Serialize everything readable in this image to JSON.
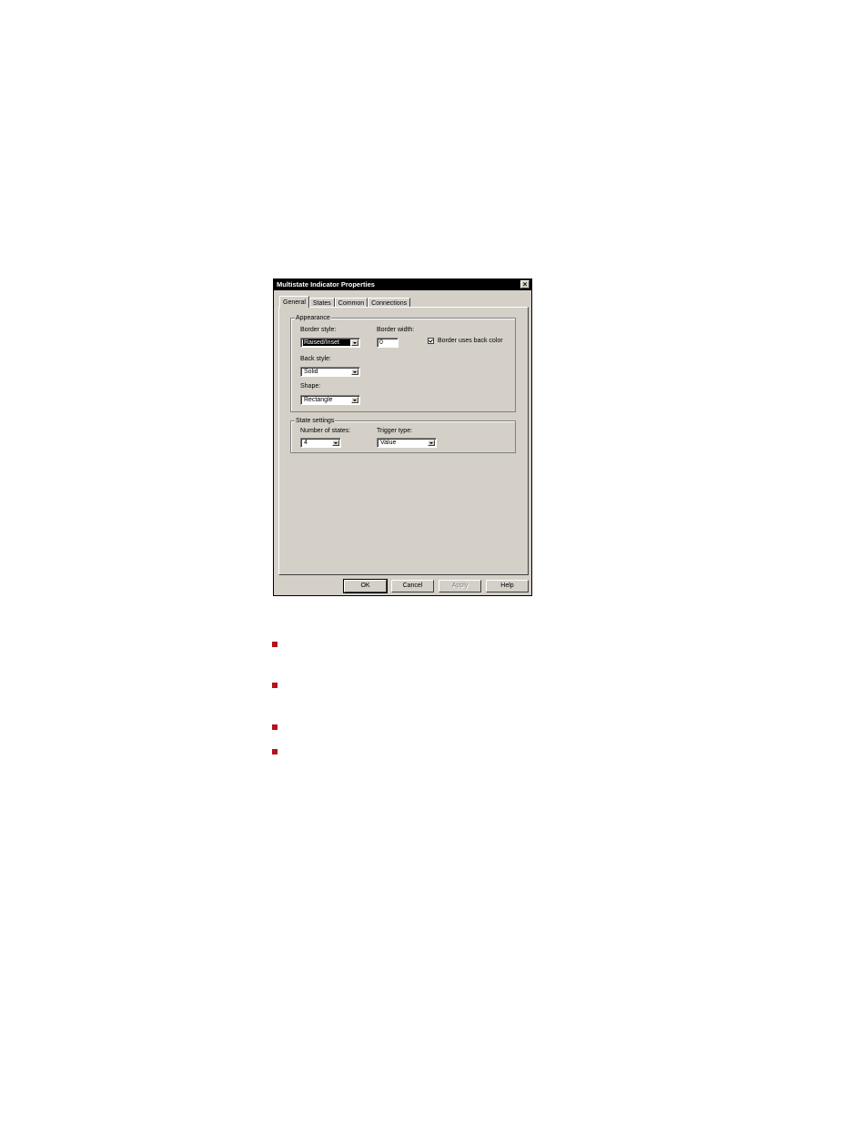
{
  "dialog": {
    "title": "Multistate Indicator Properties",
    "close_glyph": "×"
  },
  "tabs": [
    {
      "label": "General",
      "active": true
    },
    {
      "label": "States",
      "active": false
    },
    {
      "label": "Common",
      "active": false
    },
    {
      "label": "Connections",
      "active": false
    }
  ],
  "appearance": {
    "group_label": "Appearance",
    "border_style_label": "Border style:",
    "border_style_value": "Raised/Inset",
    "border_width_label": "Border width:",
    "border_width_value": "0",
    "border_uses_back_color_label": "Border uses back color",
    "border_uses_back_color_checked": true,
    "back_style_label": "Back style:",
    "back_style_value": "Solid",
    "shape_label": "Shape:",
    "shape_value": "Rectangle"
  },
  "state_settings": {
    "group_label": "State settings",
    "number_of_states_label": "Number of states:",
    "number_of_states_value": "4",
    "trigger_type_label": "Trigger type:",
    "trigger_type_value": "Value"
  },
  "buttons": {
    "ok": "OK",
    "cancel": "Cancel",
    "apply": "Apply",
    "help": "Help"
  },
  "colors": {
    "bullet": "#b5121b",
    "dialog_face": "#d4d0c8",
    "titlebar": "#000000"
  }
}
